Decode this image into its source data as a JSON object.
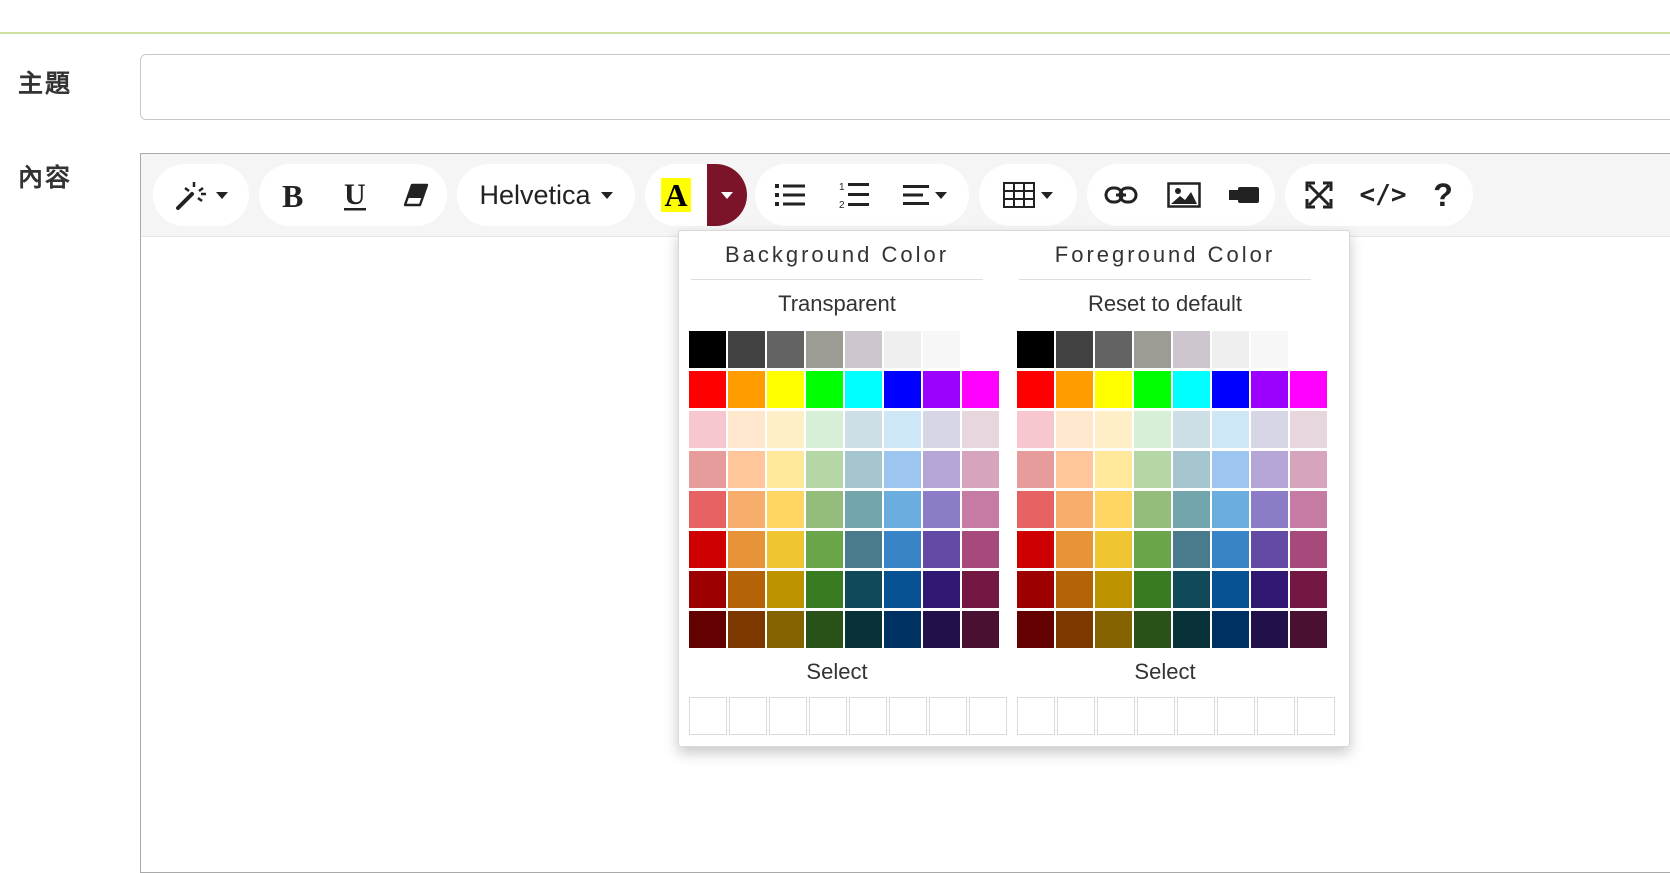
{
  "form": {
    "subject_label": "主題",
    "content_label": "內容",
    "subject_value": ""
  },
  "toolbar": {
    "font_name": "Helvetica",
    "color_letter": "A",
    "code_label": "</>",
    "help_label": "?"
  },
  "color_dropdown": {
    "background": {
      "title": "Background Color",
      "action": "Transparent",
      "select": "Select"
    },
    "foreground": {
      "title": "Foreground Color",
      "action": "Reset to default",
      "select": "Select"
    },
    "palette": [
      [
        "#000000",
        "#424242",
        "#636363",
        "#9c9c94",
        "#cec6ce",
        "#efefef",
        "#f7f7f7",
        "#ffffff"
      ],
      [
        "#ff0000",
        "#ff9c00",
        "#ffff00",
        "#00ff00",
        "#00ffff",
        "#0000ff",
        "#9c00ff",
        "#ff00ff"
      ],
      [
        "#f7c6ce",
        "#ffe7ce",
        "#ffefc6",
        "#d6efd6",
        "#cedee7",
        "#cee7f7",
        "#d6d6e7",
        "#e7d6de"
      ],
      [
        "#e79c9c",
        "#ffc69c",
        "#ffe79c",
        "#b5d6a5",
        "#a5c6ce",
        "#9cc6ef",
        "#b5a5d6",
        "#d6a5bd"
      ],
      [
        "#e76363",
        "#f7ad6b",
        "#ffd663",
        "#94bd7b",
        "#73a5ad",
        "#6badde",
        "#8c7bc6",
        "#c67ba5"
      ],
      [
        "#ce0000",
        "#e79439",
        "#efc631",
        "#6ba54a",
        "#4a7b8c",
        "#3984c6",
        "#634aa5",
        "#a54a7b"
      ],
      [
        "#9c0000",
        "#b56308",
        "#bd9400",
        "#397b21",
        "#104a5a",
        "#085294",
        "#311873",
        "#731842"
      ],
      [
        "#630000",
        "#7b3900",
        "#846300",
        "#295218",
        "#083139",
        "#003163",
        "#21104a",
        "#4a1031"
      ]
    ]
  },
  "colors": {
    "accent": "#7b1428",
    "highlight": "#ffff00",
    "toolbar_bg": "#f5f5f5",
    "top_line": "#cfdf9e"
  }
}
